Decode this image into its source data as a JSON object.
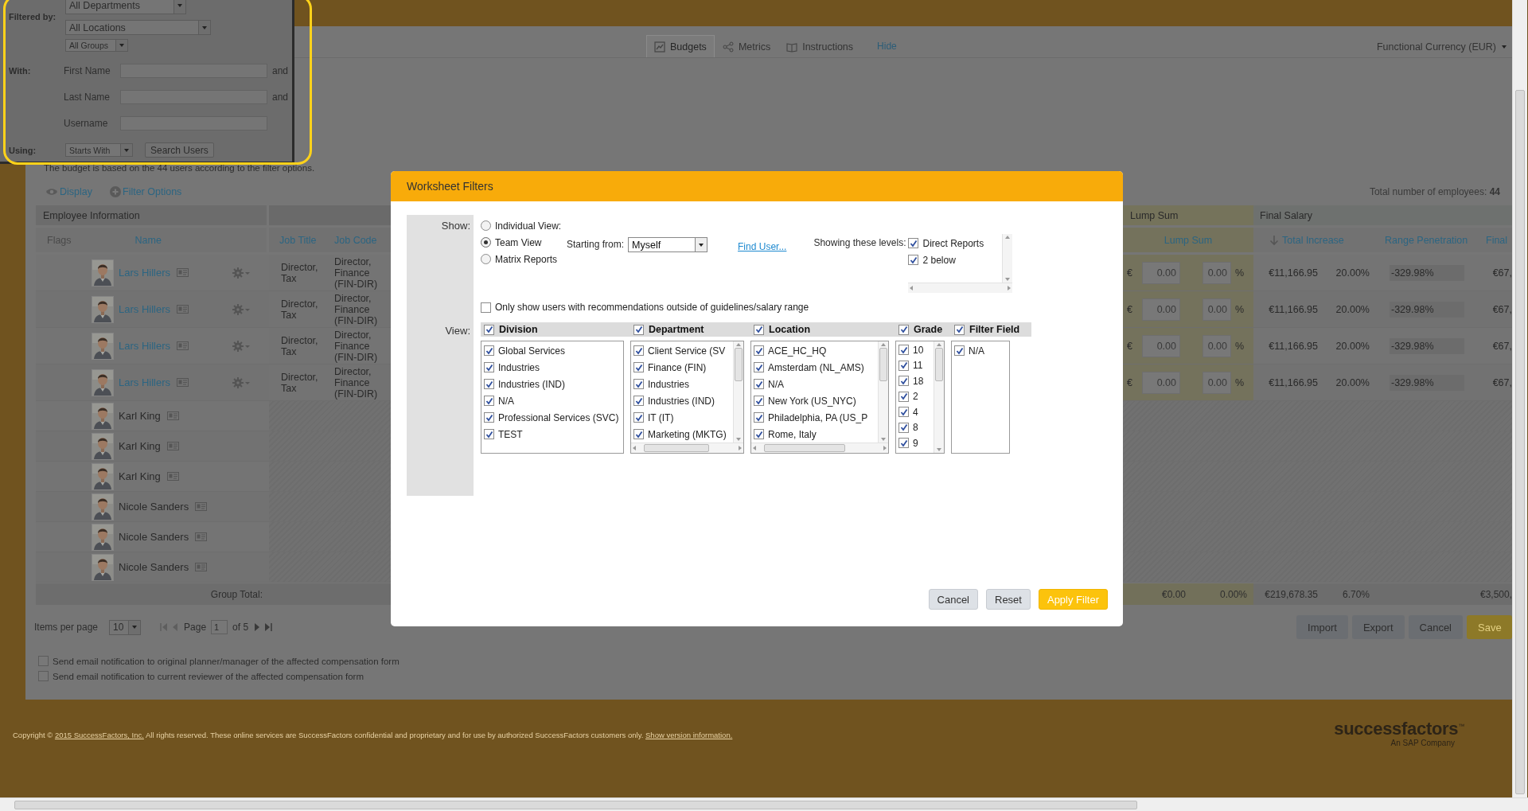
{
  "filter_popup": {
    "filtered_by_label": "Filtered by:",
    "selects": [
      {
        "value": "All Departments"
      },
      {
        "value": "All Locations"
      },
      {
        "value": "All Groups"
      }
    ],
    "with_label": "With:",
    "fields": [
      {
        "label": "First Name",
        "suffix": "and"
      },
      {
        "label": "Last Name",
        "suffix": "and"
      },
      {
        "label": "Username"
      }
    ],
    "using_label": "Using:",
    "using_value": "Starts With",
    "search_button": "Search Users"
  },
  "view_tabs": [
    {
      "label": "Budgets",
      "selected": true
    },
    {
      "label": "Metrics",
      "selected": false
    },
    {
      "label": "Instructions",
      "selected": false
    }
  ],
  "hide_link": "Hide",
  "currency": "Functional Currency (EUR)",
  "budget_note": "The budget is based on the 44 users according to the filter options.",
  "display_link": "Display",
  "filter_options_link": "Filter Options",
  "total_employees": {
    "label": "Total number of employees:",
    "value": "44"
  },
  "table": {
    "groups": [
      "Employee Information",
      "Lump Sum",
      "Final Salary"
    ],
    "columns": {
      "flags": "Flags",
      "name": "Name",
      "job_title": "Job Title",
      "job_code": "Job Code",
      "lump_sum": "Lump Sum",
      "total_increase": "Total Increase",
      "range_penetration": "Range Penetration",
      "final": "Final"
    },
    "rows": [
      {
        "name": "Lars Hillers",
        "linked": true,
        "has_actions": true,
        "job_title": "Director, Tax",
        "job_code": "Director, Finance (FIN-DIR)",
        "currency": "€",
        "lump_amount": "0.00",
        "lump_percent": "0.00",
        "percent_sign": "%",
        "total_increase": "€11,166.95",
        "increase_percent": "20.00%",
        "range_penetration": "-329.98%",
        "final": "€67,"
      },
      {
        "name": "Lars Hillers",
        "linked": true,
        "has_actions": true,
        "job_title": "Director, Tax",
        "job_code": "Director, Finance (FIN-DIR)",
        "currency": "€",
        "lump_amount": "0.00",
        "lump_percent": "0.00",
        "percent_sign": "%",
        "total_increase": "€11,166.95",
        "increase_percent": "20.00%",
        "range_penetration": "-329.98%",
        "final": "€67,"
      },
      {
        "name": "Lars Hillers",
        "linked": true,
        "has_actions": true,
        "job_title": "Director, Tax",
        "job_code": "Director, Finance (FIN-DIR)",
        "currency": "€",
        "lump_amount": "0.00",
        "lump_percent": "0.00",
        "percent_sign": "%",
        "total_increase": "€11,166.95",
        "increase_percent": "20.00%",
        "range_penetration": "-329.98%",
        "final": "€67,"
      },
      {
        "name": "Lars Hillers",
        "linked": true,
        "has_actions": true,
        "job_title": "Director, Tax",
        "job_code": "Director, Finance (FIN-DIR)",
        "currency": "€",
        "lump_amount": "0.00",
        "lump_percent": "0.00",
        "percent_sign": "%",
        "total_increase": "€11,166.95",
        "increase_percent": "20.00%",
        "range_penetration": "-329.98%",
        "final": "€67,"
      },
      {
        "name": "Karl King",
        "linked": false,
        "has_actions": false
      },
      {
        "name": "Karl King",
        "linked": false,
        "has_actions": false
      },
      {
        "name": "Karl King",
        "linked": false,
        "has_actions": false
      },
      {
        "name": "Nicole Sanders",
        "linked": false,
        "has_actions": false
      },
      {
        "name": "Nicole Sanders",
        "linked": false,
        "has_actions": false
      },
      {
        "name": "Nicole Sanders",
        "linked": false,
        "has_actions": false
      }
    ],
    "group_total": {
      "label": "Group Total:",
      "lump_amount": "€0.00",
      "lump_percent": "0.00%",
      "total_increase": "€219,678.35",
      "increase_percent": "6.70%",
      "final": "€3,500,"
    }
  },
  "pagination": {
    "items_per_page_label": "Items per page",
    "items_per_page": "10",
    "page_label": "Page",
    "page": "1",
    "of_label": "of 5",
    "can_go_back": false,
    "can_go_forward": true
  },
  "actions": [
    {
      "label": "Import",
      "kind": "default"
    },
    {
      "label": "Export",
      "kind": "default"
    },
    {
      "label": "Cancel",
      "kind": "default"
    },
    {
      "label": "Save",
      "kind": "primary"
    }
  ],
  "notifications": [
    {
      "label": "Send email notification to original planner/manager of the affected compensation form",
      "checked": false
    },
    {
      "label": "Send email notification to current reviewer of the affected compensation form",
      "checked": false
    }
  ],
  "footer": {
    "copyright_prefix": "Copyright ©",
    "copyright_link": "2015 SuccessFactors, Inc.",
    "copyright_text": "All rights reserved. These online services are SuccessFactors confidential and proprietary and for use by authorized SuccessFactors customers only.",
    "version_link": "Show version information.",
    "logo": "successfactors$^{™}$",
    "logo_tagline": "An SAP Company"
  },
  "modal": {
    "title": "Worksheet Filters",
    "show_label": "Show:",
    "view_label": "View:",
    "views": [
      {
        "label": "Individual View:",
        "selected": false
      },
      {
        "label": "Team View",
        "selected": true
      },
      {
        "label": "Matrix Reports",
        "selected": false
      }
    ],
    "starting_from_label": "Starting from:",
    "starting_from": "Myself",
    "find_user_link": "Find User...",
    "levels_label": "Showing these levels:",
    "levels": [
      {
        "label": "Direct Reports",
        "checked": true
      },
      {
        "label": "2 below",
        "checked": true
      }
    ],
    "outside_guidelines": {
      "label": "Only show users with recommendations outside of guidelines/salary range",
      "checked": false
    },
    "filters": [
      {
        "title": "Division",
        "checked": true,
        "kind": "plain",
        "items": [
          {
            "label": "Global Services",
            "checked": true
          },
          {
            "label": "Industries",
            "checked": true
          },
          {
            "label": "Industries (IND)",
            "checked": true
          },
          {
            "label": "N/A",
            "checked": true
          },
          {
            "label": "Professional Services (SVC)",
            "checked": true
          },
          {
            "label": "TEST",
            "checked": true
          }
        ]
      },
      {
        "title": "Department",
        "checked": true,
        "kind": "scrolling",
        "items": [
          {
            "label": "Client Service (SV",
            "checked": true
          },
          {
            "label": "Finance (FIN)",
            "checked": true
          },
          {
            "label": "Industries",
            "checked": true
          },
          {
            "label": "Industries (IND)",
            "checked": true
          },
          {
            "label": "IT (IT)",
            "checked": true
          },
          {
            "label": "Marketing (MKTG)",
            "checked": true
          }
        ]
      },
      {
        "title": "Location",
        "checked": true,
        "kind": "scrolling",
        "items": [
          {
            "label": "ACE_HC_HQ",
            "checked": true
          },
          {
            "label": "Amsterdam (NL_AMS)",
            "checked": true
          },
          {
            "label": "N/A",
            "checked": true
          },
          {
            "label": "New York (US_NYC)",
            "checked": true
          },
          {
            "label": "Philadelphia, PA (US_P",
            "checked": true
          },
          {
            "label": "Rome, Italy",
            "checked": true
          }
        ]
      },
      {
        "title": "Grade",
        "checked": true,
        "kind": "tall",
        "items": [
          {
            "label": "10",
            "checked": true
          },
          {
            "label": "11",
            "checked": true
          },
          {
            "label": "18",
            "checked": true
          },
          {
            "label": "2",
            "checked": true
          },
          {
            "label": "4",
            "checked": true
          },
          {
            "label": "8",
            "checked": true
          },
          {
            "label": "9",
            "checked": true
          }
        ]
      },
      {
        "title": "Filter Field",
        "checked": true,
        "kind": "plain",
        "items": [
          {
            "label": "N/A",
            "checked": true
          }
        ]
      }
    ],
    "buttons": [
      {
        "label": "Cancel",
        "kind": "default"
      },
      {
        "label": "Reset",
        "kind": "default"
      },
      {
        "label": "Apply Filter",
        "kind": "primary"
      }
    ]
  }
}
